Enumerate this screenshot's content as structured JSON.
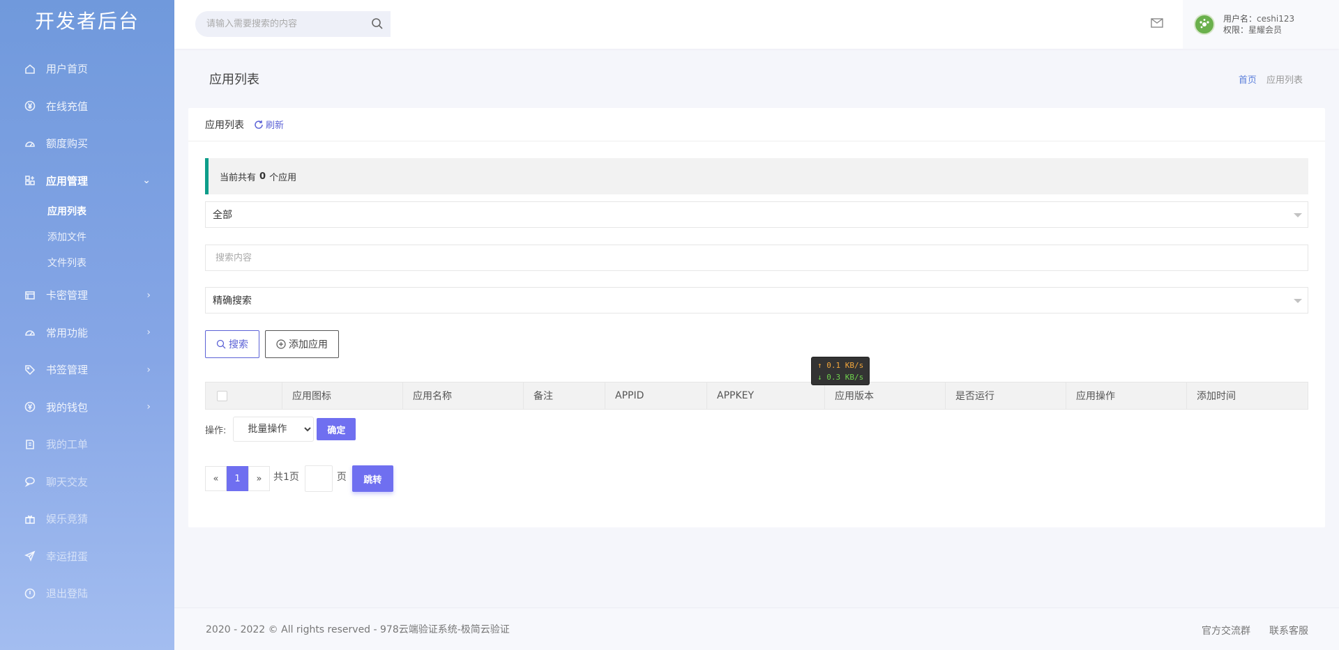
{
  "sidebar": {
    "brand": "开发者后台",
    "items": [
      {
        "label": "用户首页",
        "icon": "home-icon"
      },
      {
        "label": "在线充值",
        "icon": "yuan-icon"
      },
      {
        "label": "额度购买",
        "icon": "gauge-icon"
      },
      {
        "label": "应用管理",
        "icon": "apps-icon"
      },
      {
        "label": "卡密管理",
        "icon": "card-icon"
      },
      {
        "label": "常用功能",
        "icon": "gauge-icon"
      },
      {
        "label": "书签管理",
        "icon": "tag-icon"
      },
      {
        "label": "我的钱包",
        "icon": "wallet-icon"
      },
      {
        "label": "我的工单",
        "icon": "ticket-icon"
      },
      {
        "label": "聊天交友",
        "icon": "chat-icon"
      },
      {
        "label": "娱乐竞猜",
        "icon": "gift-icon"
      },
      {
        "label": "幸运扭蛋",
        "icon": "send-icon"
      },
      {
        "label": "退出登陆",
        "icon": "power-icon"
      }
    ],
    "submenu": [
      "应用列表",
      "添加文件",
      "文件列表"
    ]
  },
  "topbar": {
    "search_placeholder": "请输入需要搜索的内容",
    "user_label": "用户名：",
    "username": "ceshi123",
    "role_label": "权限：",
    "role": "星耀会员"
  },
  "page": {
    "title": "应用列表",
    "breadcrumb_home": "首页",
    "breadcrumb_current": "应用列表"
  },
  "card": {
    "header": "应用列表",
    "refresh": "刷新",
    "notice_prefix": "当前共有",
    "notice_count": "0",
    "notice_suffix": "个应用",
    "filter_select": "全部",
    "search_placeholder": "搜索内容",
    "mode_select": "精确搜索",
    "search_button": "搜索",
    "add_button": "添加应用"
  },
  "table": {
    "columns": [
      "应用图标",
      "应用名称",
      "备注",
      "APPID",
      "APPKEY",
      "应用版本",
      "是否运行",
      "应用操作",
      "添加时间"
    ]
  },
  "bulk": {
    "label": "操作:",
    "select": "批量操作",
    "confirm": "确定"
  },
  "pagination": {
    "prev": "«",
    "current": "1",
    "next": "»",
    "total": "共1页",
    "unit": "页",
    "go": "跳转"
  },
  "speed_widget": {
    "up": "↑ 0.1 KB/s",
    "down": "↓ 0.3 KB/s"
  },
  "footer": {
    "copyright": "2020 - 2022 © All rights reserved - 978云端验证系统-极简云验证",
    "links": [
      "官方交流群",
      "联系客服"
    ]
  }
}
